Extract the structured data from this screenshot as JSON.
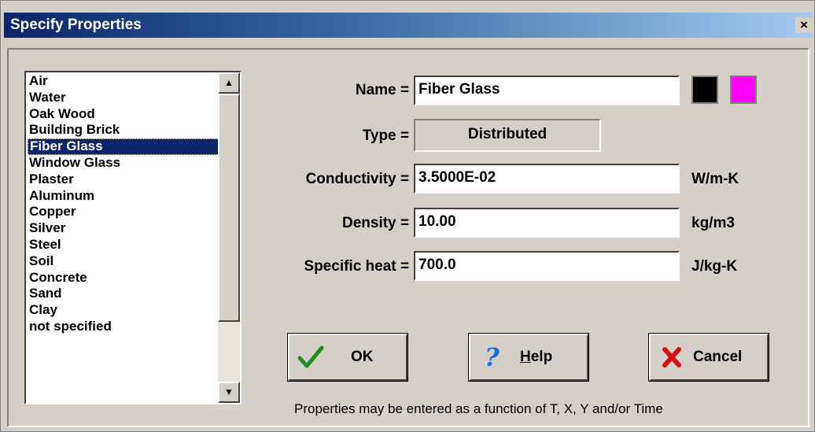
{
  "window": {
    "title": "Specify Properties",
    "close_glyph": "×"
  },
  "material_list": {
    "items": [
      "Air",
      "Water",
      "Oak Wood",
      "Building Brick",
      "Fiber Glass",
      "Window Glass",
      "Plaster",
      "Aluminum",
      "Copper",
      "Silver",
      "Steel",
      "Soil",
      "Concrete",
      "Sand",
      "Clay",
      "not specified"
    ],
    "selected": "Fiber Glass"
  },
  "form": {
    "name_label": "Name =",
    "name_value": "Fiber Glass",
    "type_label": "Type =",
    "type_value": "Distributed",
    "conductivity_label": "Conductivity =",
    "conductivity_value": "3.5000E-02",
    "conductivity_unit": "W/m-K",
    "density_label": "Density =",
    "density_value": "10.00",
    "density_unit": "kg/m3",
    "specific_heat_label": "Specific heat =",
    "specific_heat_value": "700.0",
    "specific_heat_unit": "J/kg-K"
  },
  "colors": {
    "outline_swatch": "#000000",
    "fill_swatch": "#ff00ff"
  },
  "buttons": {
    "ok": {
      "label": "OK",
      "icon": "check-icon"
    },
    "help": {
      "label_prefix": "",
      "label_mnemonic": "H",
      "label_rest": "elp",
      "icon": "question-icon"
    },
    "cancel": {
      "label": "Cancel",
      "icon": "x-icon"
    }
  },
  "footer_note": "Properties may be entered as a function of T, X, Y and/or Time"
}
